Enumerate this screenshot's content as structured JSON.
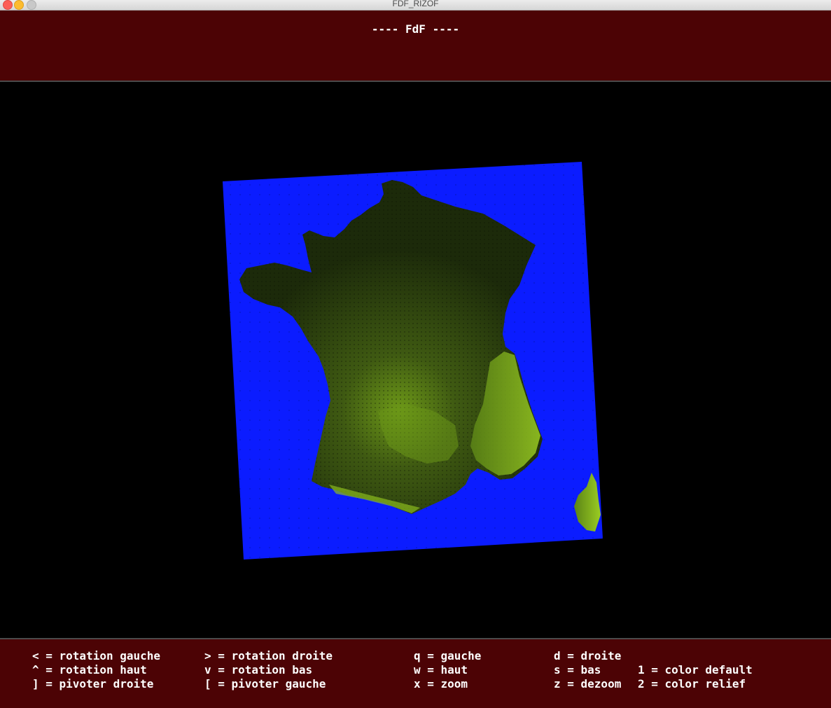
{
  "window": {
    "title": "FDF_RIZOF"
  },
  "header": {
    "title": "---- FdF ----"
  },
  "controls": {
    "rot_left": "< = rotation gauche",
    "rot_right": "> = rotation droite",
    "left": "q = gauche",
    "right": "d = droite",
    "rot_up": "^ = rotation haut",
    "rot_down": "v = rotation bas",
    "up": "w = haut",
    "down": "s = bas",
    "color_default": "1 = color default",
    "pivot_right": "] = pivoter droite",
    "pivot_left": "[ = pivoter gauche",
    "zoom": "x = zoom",
    "dezoom": "z = dezoom",
    "color_relief": "2 = color relief"
  },
  "colors": {
    "panel": "#4c0305",
    "sea": "#0b1cff",
    "land_low": "#1c2a0a",
    "land_high": "#8fbf1a"
  }
}
